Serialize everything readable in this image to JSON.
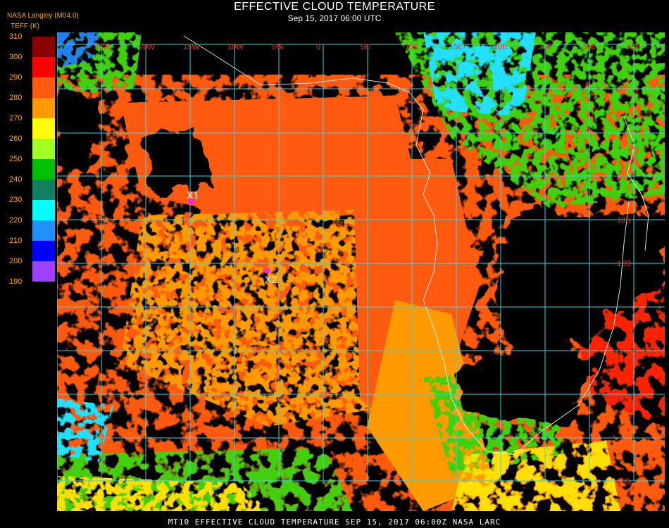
{
  "header": {
    "title": "EFFECTIVE CLOUD TEMPERATURE",
    "subtitle": "Sep 15, 2017 06:00 UTC",
    "product": "NASA Langley (M04.0)",
    "units": "TEFF (K)"
  },
  "legend": {
    "items": [
      {
        "label": "310",
        "color": "#5a0000"
      },
      {
        "label": "300",
        "color": "#8b0000"
      },
      {
        "label": "290",
        "color": "#ff0000"
      },
      {
        "label": "280",
        "color": "#ff5a10"
      },
      {
        "label": "270",
        "color": "#ff9a00"
      },
      {
        "label": "260",
        "color": "#ffff00"
      },
      {
        "label": "250",
        "color": "#a0ff20"
      },
      {
        "label": "240",
        "color": "#00c000"
      },
      {
        "label": "230",
        "color": "#108060"
      },
      {
        "label": "220",
        "color": "#00ffff"
      },
      {
        "label": "210",
        "color": "#2090ff"
      },
      {
        "label": "200",
        "color": "#0000ff"
      },
      {
        "label": "190",
        "color": "#a040ff"
      }
    ]
  },
  "map": {
    "grid_color": "#40d0e0",
    "colors": {
      "clear": "#000000",
      "warm": "#ff5a10",
      "mid": "#ff9a00",
      "green": "#40d010",
      "yellow": "#ffe000",
      "cyan": "#20e0ff",
      "blue": "#2080ff",
      "red": "#ff2000",
      "coast": "#ffffff"
    },
    "longitude_labels": [
      "25W",
      "20W",
      "15W",
      "10W",
      "5W",
      "0",
      "5E",
      "10E",
      "15E",
      "20E",
      "25E",
      "30E",
      "35E"
    ],
    "latitude_labels": [
      "10S",
      "15S",
      "40S"
    ],
    "markers": [
      {
        "label": "X1",
        "color": "#ff20ff"
      },
      {
        "label": "X2",
        "color": "#ff20ff"
      }
    ]
  },
  "footer": {
    "text": "MT10  EFFECTIVE CLOUD TEMPERATURE    SEP 15, 2017 06:00Z    NASA LARC"
  }
}
